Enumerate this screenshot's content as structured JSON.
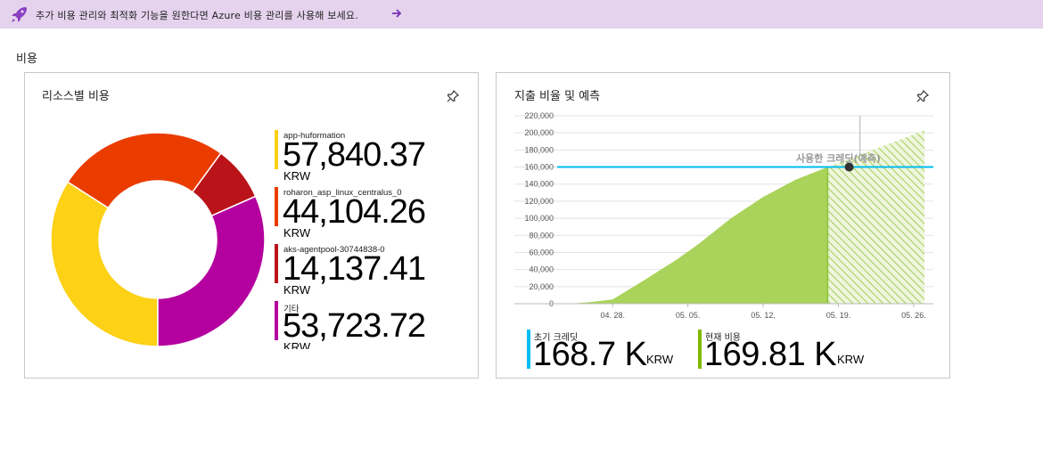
{
  "banner": {
    "text": "추가 비용 관리와 최적화 기능을 원한다면 Azure 비용 관리를 사용해 보세요."
  },
  "section_title": "비용",
  "resource_card": {
    "title": "리소스별 비용",
    "items": [
      {
        "name": "app-huformation",
        "value": "57,840.37",
        "unit": "KRW",
        "color": "#fcd116"
      },
      {
        "name": "roharon_asp_linux_centralus_0",
        "value": "44,104.26",
        "unit": "KRW",
        "color": "#eb3c00"
      },
      {
        "name": "aks-agentpool-30744838-0",
        "value": "14,137.41",
        "unit": "KRW",
        "color": "#ba141a"
      },
      {
        "name": "기타",
        "value": "53,723.72",
        "unit": "KRW",
        "color": "#b4009e"
      }
    ]
  },
  "spend_card": {
    "title": "지출 비율 및 예측",
    "annotation": "사용한 크레딧(예측)",
    "kpis": [
      {
        "label": "초기 크레딧",
        "value": "168.7 K",
        "unit": "KRW",
        "color": "#00bcf2"
      },
      {
        "label": "현재 비용",
        "value": "169.81 K",
        "unit": "KRW",
        "color": "#7fba00"
      }
    ]
  },
  "chart_data": [
    {
      "type": "pie",
      "title": "리소스별 비용",
      "categories": [
        "app-huformation",
        "roharon_asp_linux_centralus_0",
        "aks-agentpool-30744838-0",
        "기타"
      ],
      "values": [
        57840.37,
        44104.26,
        14137.41,
        53723.72
      ],
      "colors": [
        "#fcd116",
        "#eb3c00",
        "#ba141a",
        "#b4009e"
      ],
      "donut": true
    },
    {
      "type": "area",
      "title": "지출 비율 및 예측",
      "x_ticks": [
        "04. 28.",
        "05. 05.",
        "05. 12.",
        "05. 19.",
        "05. 26."
      ],
      "y_ticks": [
        "0",
        "20,000",
        "40,000",
        "60,000",
        "80,000",
        "100,000",
        "120,000",
        "140,000",
        "160,000",
        "180,000",
        "200,000",
        "220,000"
      ],
      "ylim": [
        0,
        220000
      ],
      "grid": true,
      "series": [
        {
          "name": "현재 비용",
          "color": "#a9d35a",
          "x": [
            "04. 24.",
            "04. 26.",
            "04. 28.",
            "05. 01.",
            "05. 04.",
            "05. 06.",
            "05. 09.",
            "05. 12.",
            "05. 15.",
            "05. 17.",
            "05. 18."
          ],
          "y": [
            0,
            2000,
            5000,
            28000,
            52000,
            70000,
            100000,
            125000,
            145000,
            155000,
            160000
          ]
        },
        {
          "name": "사용한 크레딧(예측)",
          "color": "#c5e09a",
          "pattern": "hatched",
          "x": [
            "05. 18.",
            "05. 27."
          ],
          "y": [
            160000,
            203000
          ]
        }
      ],
      "reference_line": {
        "name": "초기 크레딧",
        "y": 168700,
        "color": "#00bcf2"
      },
      "marker": {
        "x": "05. 20.",
        "y": 169810
      }
    }
  ]
}
